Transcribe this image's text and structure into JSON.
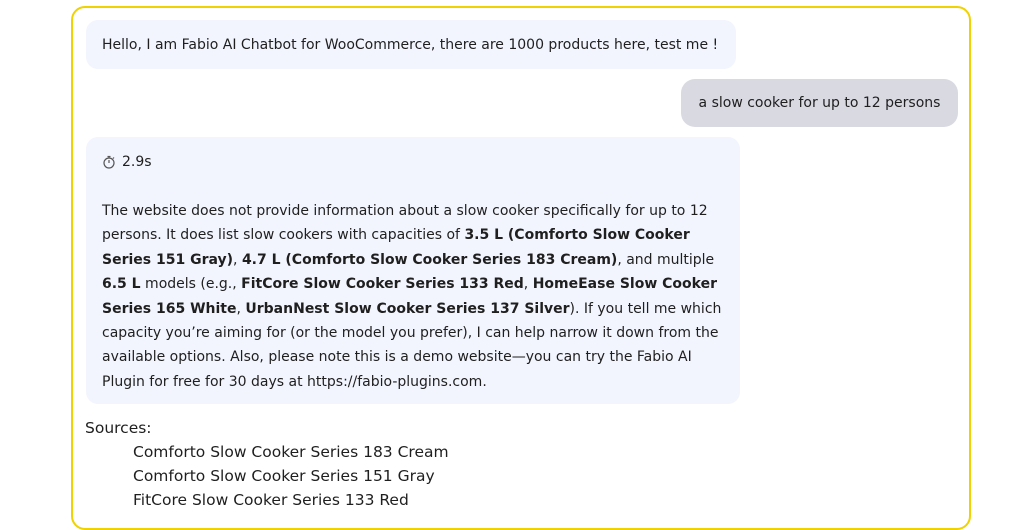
{
  "chat": {
    "greeting": "Hello, I am Fabio AI Chatbot for WooCommerce, there are 1000 products here, test me !",
    "user_message": "a slow cooker for up to 12 persons",
    "response_time": "2.9s",
    "timer_icon": "stopwatch-icon",
    "answer": {
      "t1": "The website does not provide information about a slow cooker specifically for up to 12 persons. It does list slow cookers with capacities of ",
      "b1": "3.5 L (Comforto Slow Cooker Series 151 Gray)",
      "t2": ", ",
      "b2": "4.7 L (Comforto Slow Cooker Series 183 Cream)",
      "t3": ", and multiple ",
      "b3": "6.5 L",
      "t4": " models (e.g., ",
      "b4": "FitCore Slow Cooker Series 133 Red",
      "t5": ", ",
      "b5": "HomeEase Slow Cooker Series 165 White",
      "t6": ", ",
      "b6": "UrbanNest Slow Cooker Series 137 Silver",
      "t7": "). If you tell me which capacity you’re aiming for (or the model you prefer), I can help narrow it down from the available options. Also, please note this is a demo website—you can try the Fabio AI Plugin for free for 30 days at https://fabio-plugins.com."
    },
    "sources_title": "Sources:",
    "sources": [
      "Comforto Slow Cooker Series 183 Cream",
      "Comforto Slow Cooker Series 151 Gray",
      "FitCore Slow Cooker Series 133 Red"
    ]
  },
  "colors": {
    "frame_border": "#f0d200",
    "bot_bubble": "#f2f5fe",
    "user_bubble": "#d9d9e2"
  }
}
